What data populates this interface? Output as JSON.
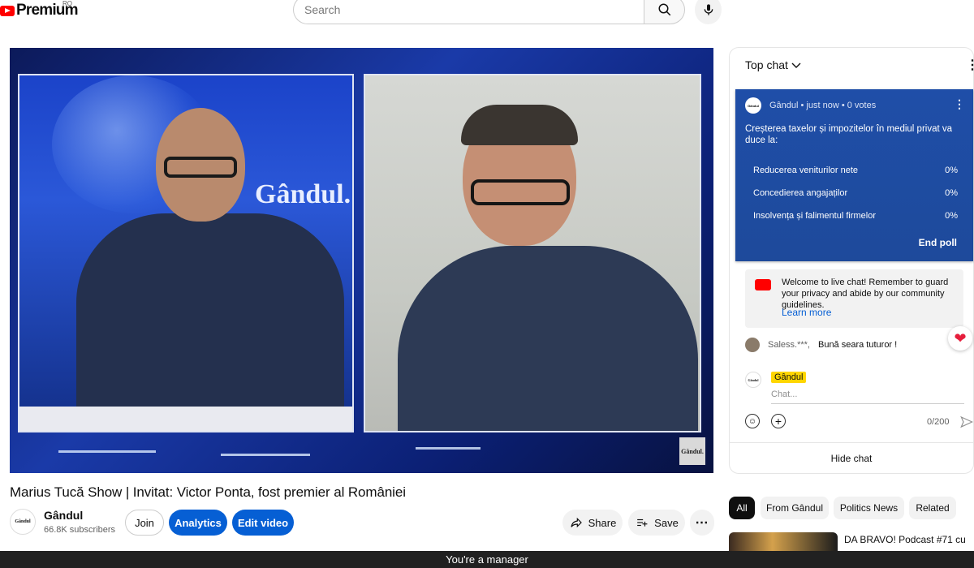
{
  "header": {
    "logo_text": "Premium",
    "region": "RO",
    "search_placeholder": "Search"
  },
  "video": {
    "overlay_brand": "Gândul.",
    "corner_bug": "Gândul."
  },
  "video_info": {
    "title": "Marius Tucă Show | Invitat: Victor Ponta, fost premier al României",
    "channel_name": "Gândul",
    "subscribers": "66.8K subscribers",
    "avatar_text": "Gândul",
    "join_label": "Join",
    "analytics_label": "Analytics",
    "edit_label": "Edit video",
    "share_label": "Share",
    "save_label": "Save"
  },
  "chat": {
    "mode_label": "Top chat",
    "poll": {
      "meta": "Gândul • just now • 0 votes",
      "question": "Creșterea taxelor și impozitelor în mediul privat va duce la:",
      "options": [
        {
          "label": "Reducerea veniturilor nete",
          "percent": "0%"
        },
        {
          "label": "Concedierea angajaților",
          "percent": "0%"
        },
        {
          "label": "Insolvența și falimentul firmelor",
          "percent": "0%"
        }
      ],
      "end_label": "End poll"
    },
    "welcome_text": "Welcome to live chat! Remember to guard your privacy and abide by our community guidelines.",
    "learn_more": "Learn more",
    "messages": [
      {
        "author": "Saless.***,",
        "text": "Bună seara tuturor !"
      }
    ],
    "compose_author": "Gândul",
    "input_placeholder": "Chat...",
    "counter": "0/200",
    "hide_label": "Hide chat"
  },
  "chips": [
    "All",
    "From Gândul",
    "Politics News",
    "Related"
  ],
  "recommendation": {
    "title": "DA BRAVO! Podcast #71 cu"
  },
  "manager_bar": "You're a manager",
  "colors": {
    "brand_red": "#ff0000",
    "primary_blue": "#065fd4",
    "poll_blue": "#1f4aa0"
  }
}
